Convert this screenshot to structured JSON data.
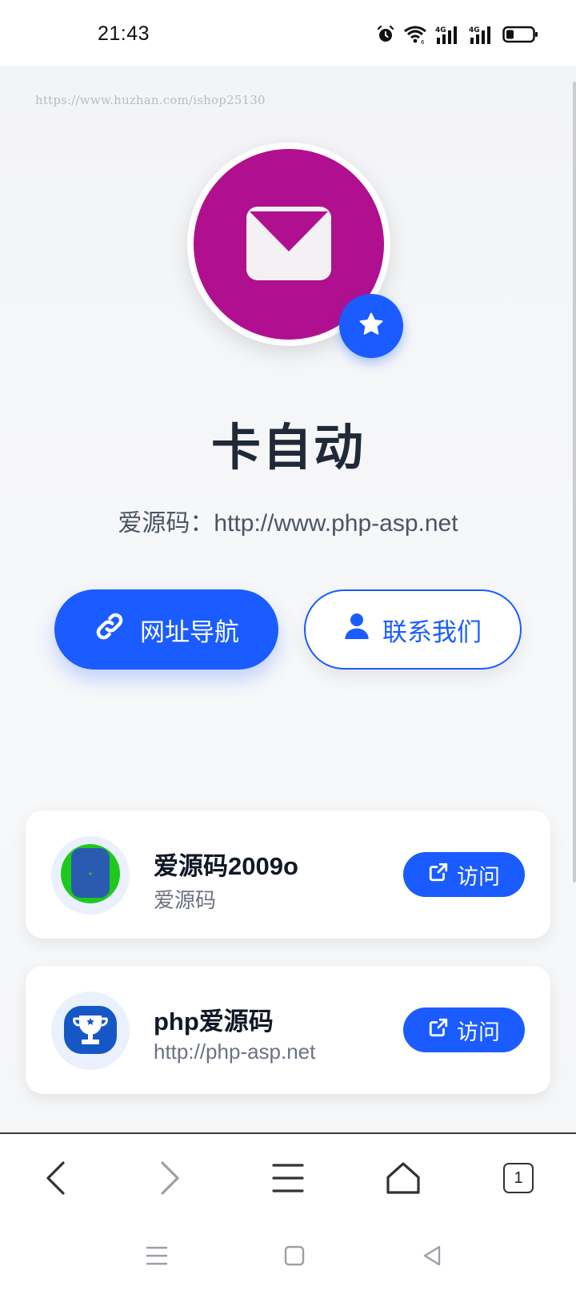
{
  "status_bar": {
    "time": "21:43",
    "icons": [
      "alarm-icon",
      "wifi-icon",
      "signal-4g-icon",
      "signal-4g-icon",
      "battery-icon"
    ]
  },
  "page": {
    "watermark": "https://www.huzhan.com/ishop25130",
    "avatar_icon": "mail-icon",
    "badge_icon": "star-icon",
    "title": "卡自动",
    "subtitle": "爱源码：http://www.php-asp.net",
    "buttons": {
      "nav_label": "网址导航",
      "nav_icon": "link-icon",
      "contact_label": "联系我们",
      "contact_icon": "user-icon"
    },
    "colors": {
      "accent": "#1a5cff",
      "avatar_bg": "#b0108f"
    }
  },
  "cards": [
    {
      "title": "爱源码2009o",
      "subtitle": "爱源码",
      "button": "访问",
      "icon": "green-badge-icon"
    },
    {
      "title": "php爱源码",
      "subtitle": "http://php-asp.net",
      "button": "访问",
      "icon": "trophy-icon"
    }
  ],
  "browser_nav": {
    "items": [
      "back-icon",
      "forward-icon",
      "menu-icon",
      "home-icon",
      "tabs-icon"
    ],
    "tab_count": "1"
  }
}
